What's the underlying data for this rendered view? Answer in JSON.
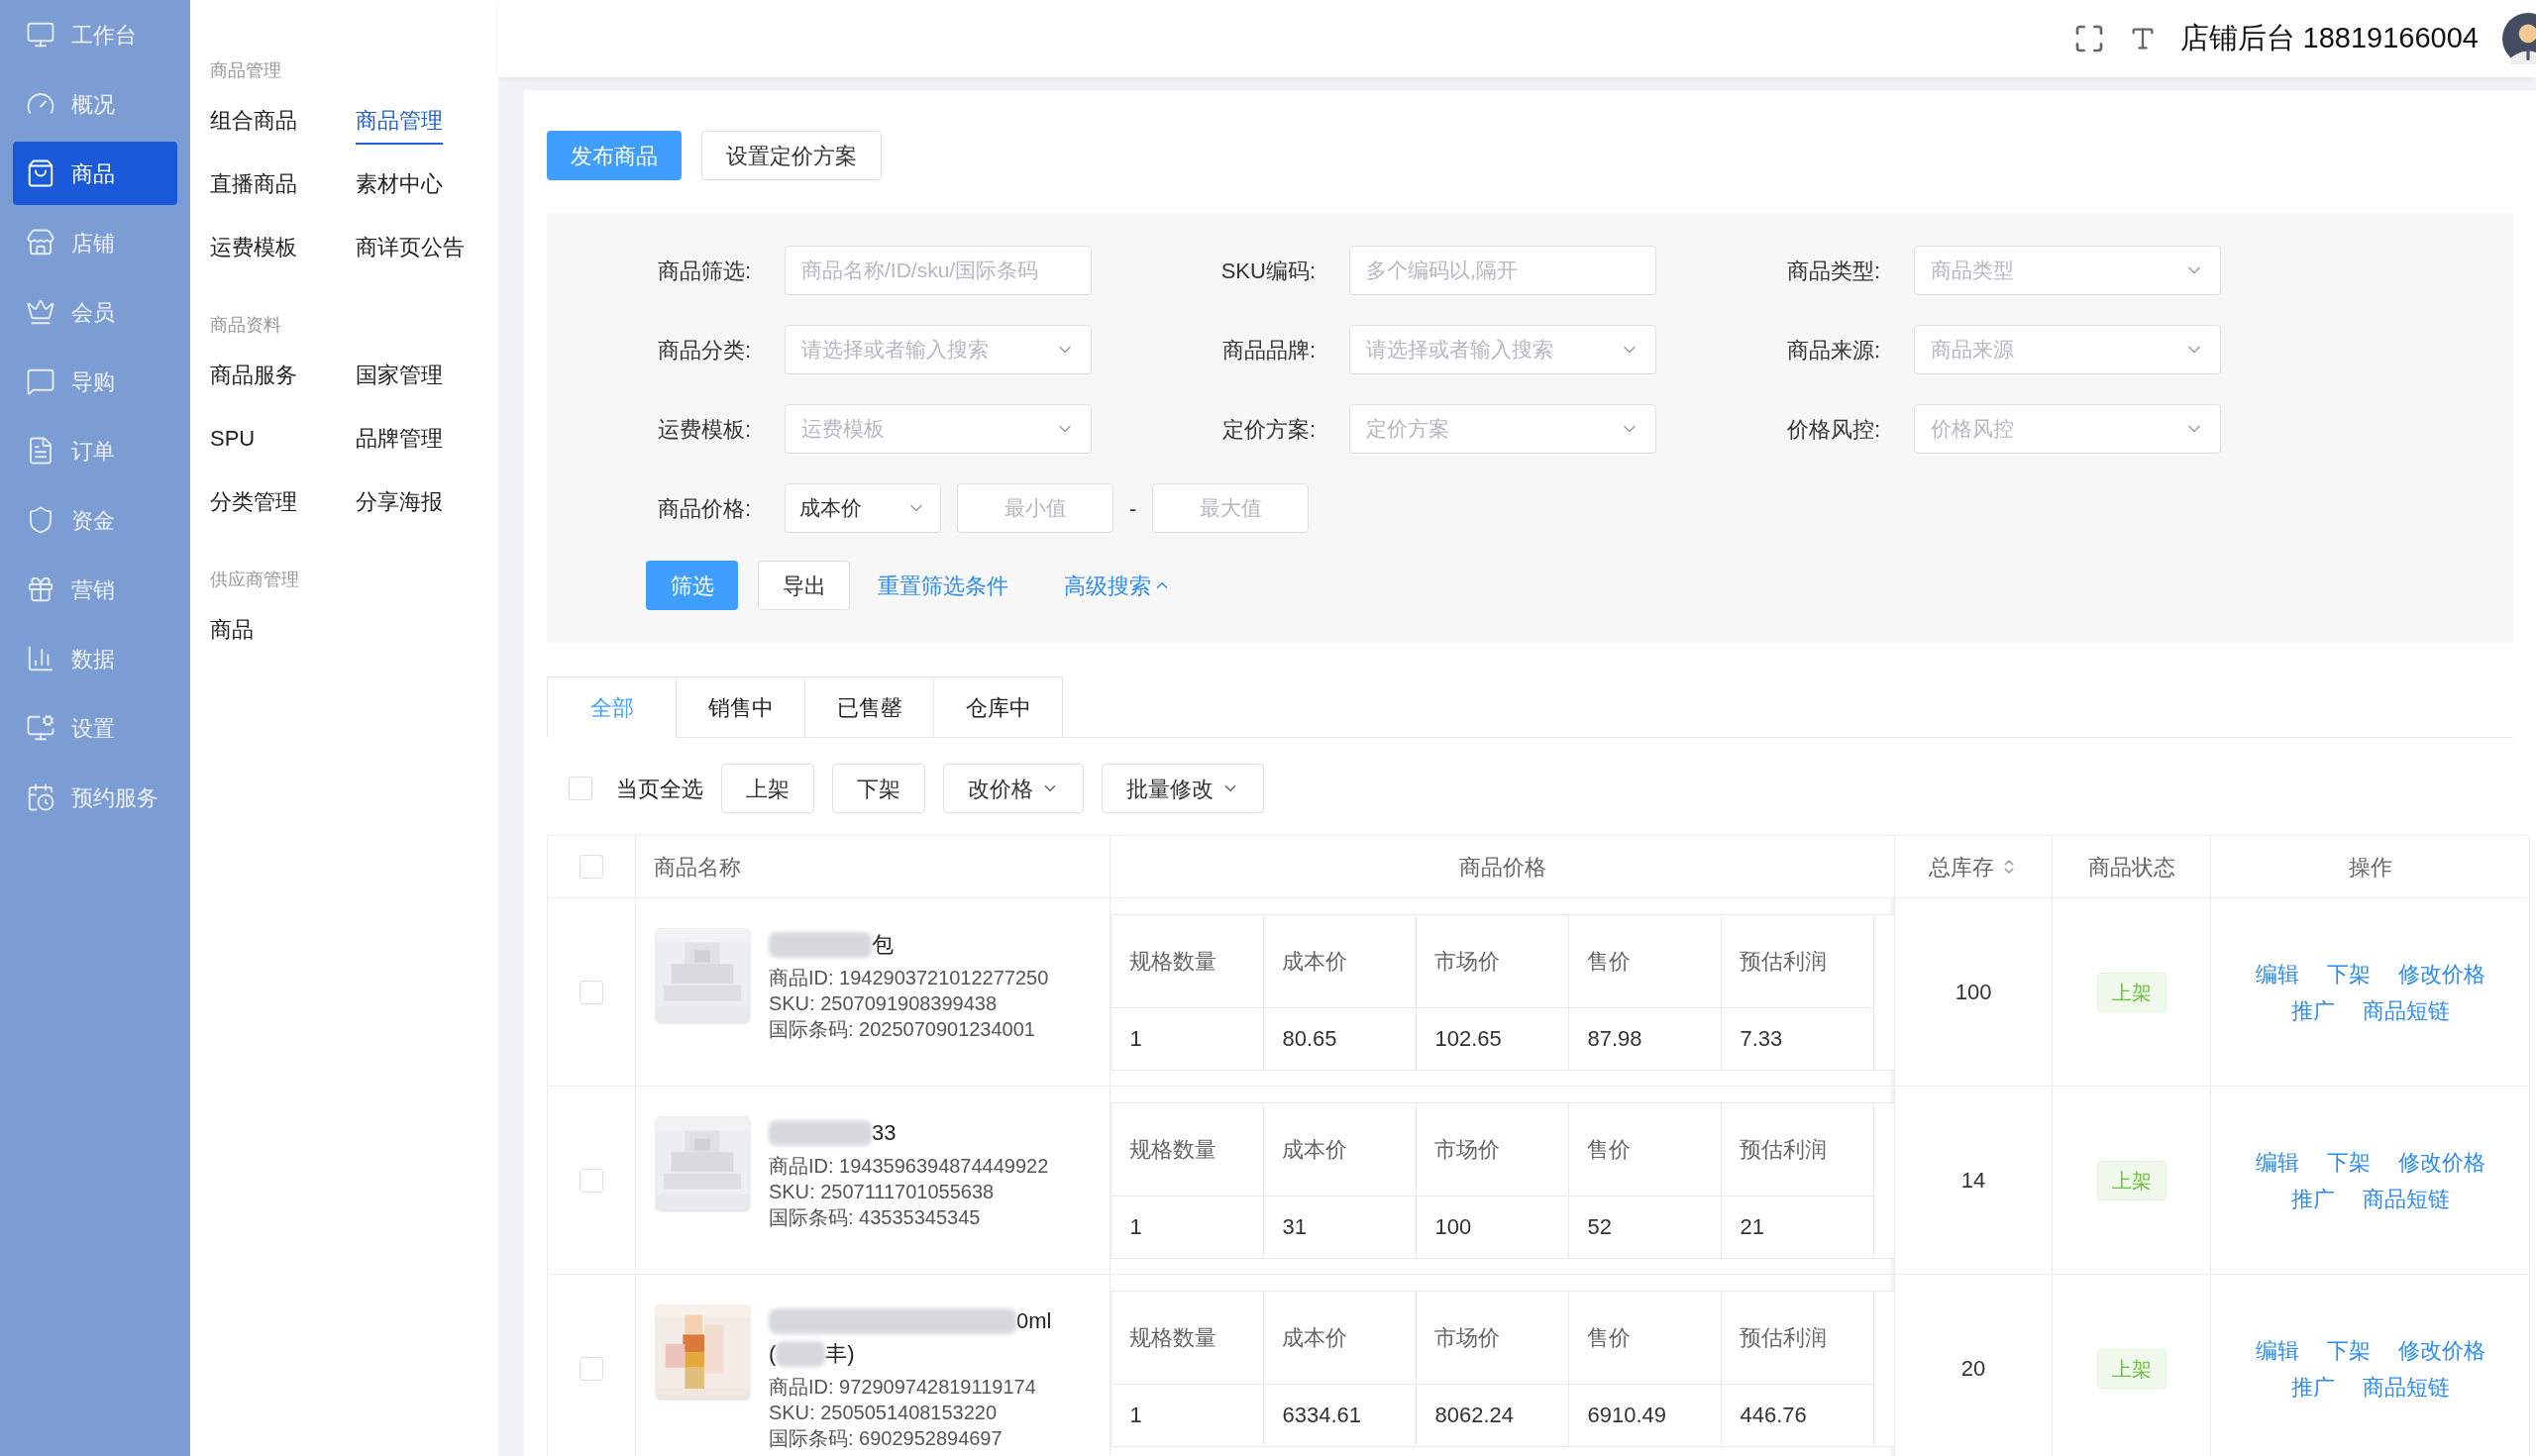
{
  "sidebar": {
    "items": [
      {
        "label": "工作台",
        "selected": false
      },
      {
        "label": "概况",
        "selected": false
      },
      {
        "label": "商品",
        "selected": true
      },
      {
        "label": "店铺",
        "selected": false
      },
      {
        "label": "会员",
        "selected": false
      },
      {
        "label": "导购",
        "selected": false
      },
      {
        "label": "订单",
        "selected": false
      },
      {
        "label": "资金",
        "selected": false
      },
      {
        "label": "营销",
        "selected": false
      },
      {
        "label": "数据",
        "selected": false
      },
      {
        "label": "设置",
        "selected": false
      },
      {
        "label": "预约服务",
        "selected": false
      }
    ]
  },
  "subnav": {
    "groups": [
      {
        "title": "商品管理",
        "items": [
          {
            "label": "组合商品",
            "selected": false
          },
          {
            "label": "商品管理",
            "selected": true
          },
          {
            "label": "直播商品",
            "selected": false
          },
          {
            "label": "素材中心",
            "selected": false
          },
          {
            "label": "运费模板",
            "selected": false
          },
          {
            "label": "商详页公告",
            "selected": false
          }
        ]
      },
      {
        "title": "商品资料",
        "items": [
          {
            "label": "商品服务",
            "selected": false
          },
          {
            "label": "国家管理",
            "selected": false
          },
          {
            "label": "SPU",
            "selected": false
          },
          {
            "label": "品牌管理",
            "selected": false
          },
          {
            "label": "分类管理",
            "selected": false
          },
          {
            "label": "分享海报",
            "selected": false
          }
        ]
      },
      {
        "title": "供应商管理",
        "items": [
          {
            "label": "商品",
            "selected": false
          }
        ]
      }
    ]
  },
  "header": {
    "title": "店铺后台 18819166004"
  },
  "actions": [
    {
      "label": "发布商品",
      "kind": "primary"
    },
    {
      "label": "设置定价方案",
      "kind": "default"
    }
  ],
  "filters": [
    {
      "label": "商品筛选:",
      "kind": "input",
      "placeholder": "商品名称/ID/sku/国际条码"
    },
    {
      "label": "SKU编码:",
      "kind": "input",
      "placeholder": "多个编码以,隔开"
    },
    {
      "label": "商品类型:",
      "kind": "select",
      "placeholder": "商品类型"
    },
    {
      "label": "商品分类:",
      "kind": "select",
      "placeholder": "请选择或者输入搜索"
    },
    {
      "label": "商品品牌:",
      "kind": "select",
      "placeholder": "请选择或者输入搜索"
    },
    {
      "label": "商品来源:",
      "kind": "select",
      "placeholder": "商品来源"
    },
    {
      "label": "运费模板:",
      "kind": "select",
      "placeholder": "运费模板"
    },
    {
      "label": "定价方案:",
      "kind": "select",
      "placeholder": "定价方案"
    },
    {
      "label": "价格风控:",
      "kind": "select",
      "placeholder": "价格风控"
    },
    {
      "label": "商品价格:",
      "kind": "range",
      "value": "成本价",
      "min_placeholder": "最小值",
      "separator": "-",
      "max_placeholder": "最大值"
    }
  ],
  "filter_buttons": [
    {
      "label": "筛选",
      "kind": "primary"
    },
    {
      "label": "导出",
      "kind": "default"
    },
    {
      "label": "重置筛选条件",
      "kind": "link"
    },
    {
      "label": "高级搜索",
      "kind": "toggle"
    }
  ],
  "tabs": [
    {
      "label": "全部",
      "selected": true
    },
    {
      "label": "销售中",
      "selected": false
    },
    {
      "label": "已售罄",
      "selected": false
    },
    {
      "label": "仓库中",
      "selected": false
    }
  ],
  "bulk": {
    "select_all": {
      "label": "当页全选",
      "checked": false
    },
    "buttons": [
      {
        "label": "上架",
        "dropdown": false
      },
      {
        "label": "下架",
        "dropdown": false
      },
      {
        "label": "改价格",
        "dropdown": true
      },
      {
        "label": "批量修改",
        "dropdown": true
      }
    ]
  },
  "table": {
    "header_checked": false,
    "columns": [
      "商品名称",
      "商品价格",
      "总库存",
      "商品状态",
      "操作"
    ],
    "rows": [
      {
        "checked": false,
        "name_lines": [
          [
            {
              "kind": "blur"
            },
            {
              "kind": "text",
              "text": "包"
            }
          ]
        ],
        "product_id": "商品ID: 1942903721012277250",
        "sku": "SKU: 2507091908399438",
        "barcode": "国际条码: 2025070901234001",
        "price_headers": [
          "规格数量",
          "成本价",
          "市场价",
          "售价",
          "预估利润"
        ],
        "price_values": [
          "1",
          "80.65",
          "102.65",
          "87.98",
          "7.33"
        ],
        "stock": "100",
        "status": "上架",
        "actions": [
          "编辑",
          "下架",
          "修改价格",
          "推广",
          "商品短链"
        ]
      },
      {
        "checked": false,
        "name_lines": [
          [
            {
              "kind": "blur"
            },
            {
              "kind": "text",
              "text": "33"
            }
          ]
        ],
        "product_id": "商品ID: 1943596394874449922",
        "sku": "SKU: 2507111701055638",
        "barcode": "国际条码: 43535345345",
        "price_headers": [
          "规格数量",
          "成本价",
          "市场价",
          "售价",
          "预估利润"
        ],
        "price_values": [
          "1",
          "31",
          "100",
          "52",
          "21"
        ],
        "stock": "14",
        "status": "上架",
        "actions": [
          "编辑",
          "下架",
          "修改价格",
          "推广",
          "商品短链"
        ]
      },
      {
        "checked": false,
        "name_lines": [
          [
            {
              "kind": "blur"
            },
            {
              "kind": "text",
              "text": "0ml"
            }
          ],
          [
            {
              "kind": "text",
              "text": "("
            },
            {
              "kind": "blur"
            },
            {
              "kind": "text",
              "text": "丰)"
            }
          ]
        ],
        "product_id": "商品ID: 972909742819119174",
        "sku": "SKU: 2505051408153220",
        "barcode": "国际条码: 6902952894697",
        "price_headers": [
          "规格数量",
          "成本价",
          "市场价",
          "售价",
          "预估利润"
        ],
        "price_values": [
          "1",
          "6334.61",
          "8062.24",
          "6910.49",
          "446.76"
        ],
        "stock": "20",
        "status": "上架",
        "actions": [
          "编辑",
          "下架",
          "修改价格",
          "推广",
          "商品短链"
        ]
      }
    ]
  }
}
